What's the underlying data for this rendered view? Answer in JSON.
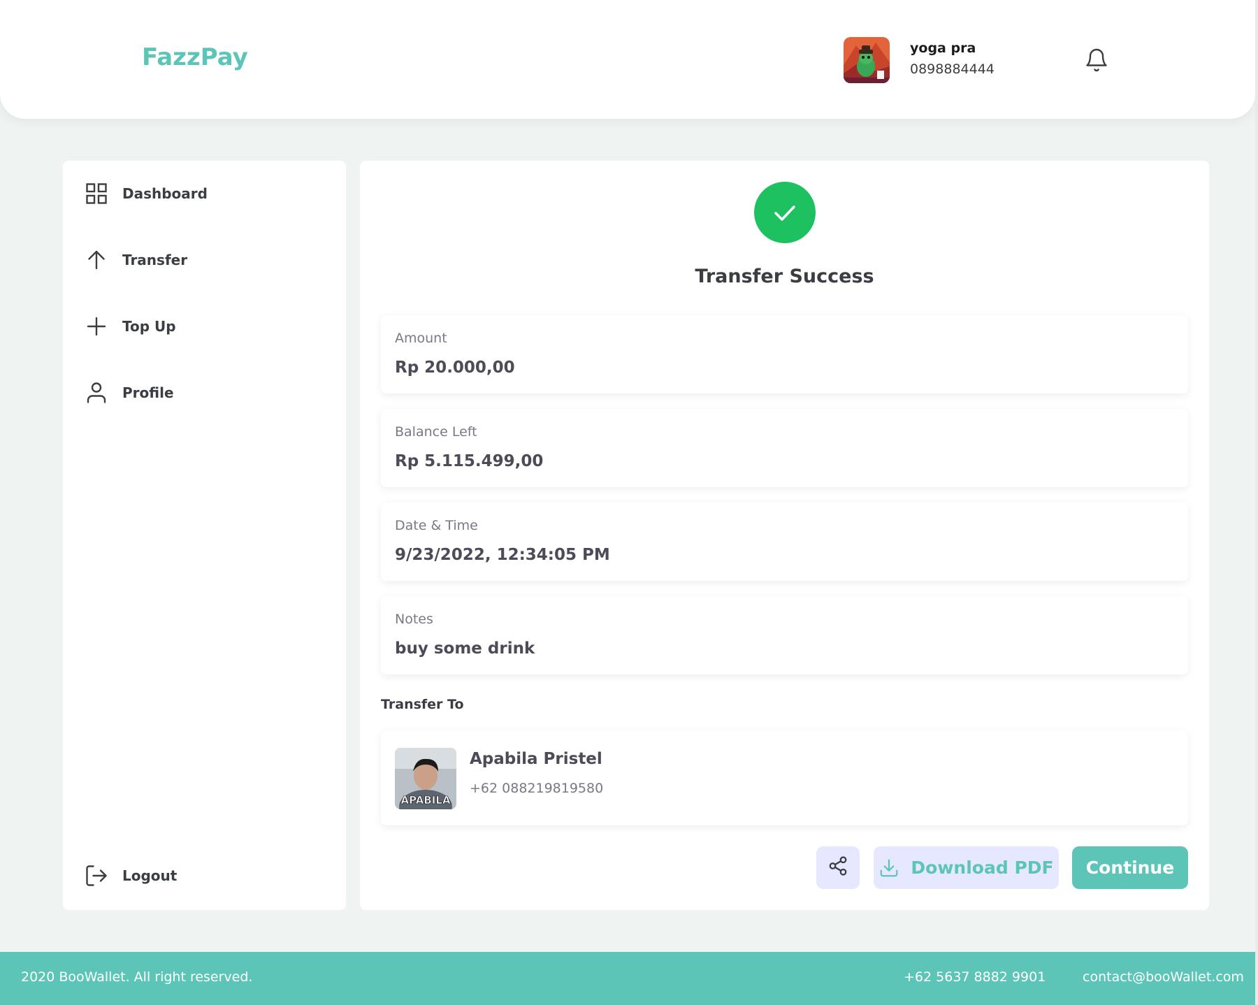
{
  "header": {
    "brand": "FazzPay",
    "user": {
      "name": "yoga pra",
      "phone": "0898884444"
    }
  },
  "sidebar": {
    "items": [
      {
        "label": "Dashboard",
        "icon": "grid-icon"
      },
      {
        "label": "Transfer",
        "icon": "arrow-up-icon"
      },
      {
        "label": "Top Up",
        "icon": "plus-icon"
      },
      {
        "label": "Profile",
        "icon": "user-icon"
      }
    ],
    "logout": {
      "label": "Logout",
      "icon": "logout-icon"
    }
  },
  "main": {
    "title": "Transfer Success",
    "details": [
      {
        "label": "Amount",
        "value": "Rp 20.000,00"
      },
      {
        "label": "Balance Left",
        "value": "Rp 5.115.499,00"
      },
      {
        "label": "Date & Time",
        "value": "9/23/2022, 12:34:05 PM"
      },
      {
        "label": "Notes",
        "value": "buy some drink"
      }
    ],
    "transfer_to_label": "Transfer To",
    "recipient": {
      "name": "Apabila Pristel",
      "phone": "+62 088219819580",
      "avatar_caption": "APABILA"
    },
    "buttons": {
      "download_pdf": "Download PDF",
      "continue": "Continue"
    }
  },
  "footer": {
    "copyright": "2020 BooWallet. All right reserved.",
    "phone": "+62 5637 8882 9901",
    "email": "contact@booWallet.com"
  },
  "colors": {
    "accent": "#5cc5b7",
    "success": "#1ec15f",
    "button_bg": "#e5e8ff",
    "page_bg": "#eff3f2"
  }
}
